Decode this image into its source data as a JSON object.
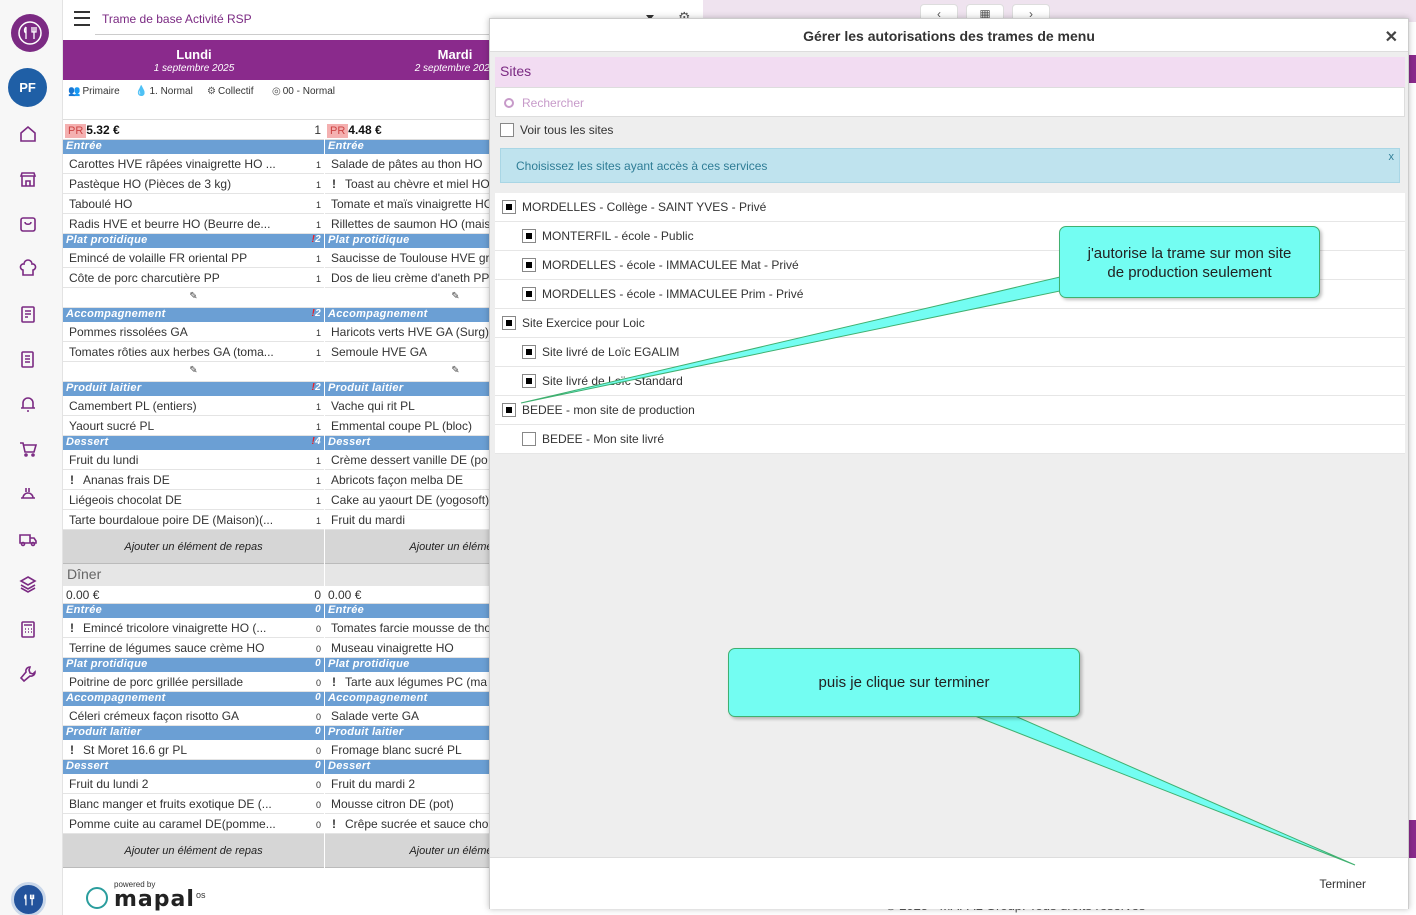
{
  "sidebar": {
    "avatar_initials": "PF",
    "icons": [
      "home-icon",
      "store-icon",
      "basket-icon",
      "chef-hat-icon",
      "recipe-icon",
      "document-icon",
      "bell-icon",
      "cart-icon",
      "dish-icon",
      "delivery-icon",
      "layers-icon",
      "calculator-icon",
      "wrench-icon"
    ]
  },
  "topbar": {
    "trame": "Trame de base Activité RSP",
    "prev": "‹",
    "next": "›",
    "calendar": "▦"
  },
  "days": [
    {
      "name": "Lundi",
      "date": "1 septembre 2025"
    },
    {
      "name": "Mardi",
      "date": "2 septembre 2025"
    }
  ],
  "attributes": [
    "Primaire",
    "1. Normal",
    "Collectif",
    "00 - Normal"
  ],
  "lunch": {
    "pr_label": "PR",
    "lundi": {
      "price": "5.32 €",
      "count": "1",
      "entree": [
        {
          "t": "Carottes HVE râpées vinaigrette HO ...",
          "q": "1"
        },
        {
          "t": "Pastèque HO (Pièces de 3 kg)",
          "q": "1"
        },
        {
          "t": "Taboulé HO",
          "q": "1"
        },
        {
          "t": "Radis HVE et beurre HO (Beurre de...",
          "q": "1"
        }
      ],
      "plat_count": "2",
      "plat": [
        {
          "t": "Emincé de volaille FR oriental PP",
          "q": "1"
        },
        {
          "t": "Côte de porc charcutière PP",
          "q": "1"
        }
      ],
      "acc_count": "2",
      "acc": [
        {
          "t": "Pommes rissolées GA",
          "q": "1"
        },
        {
          "t": "Tomates rôties aux herbes GA (toma...",
          "q": "1"
        }
      ],
      "lait_count": "2",
      "lait": [
        {
          "t": "Camembert PL (entiers)",
          "q": "1"
        },
        {
          "t": "Yaourt sucré PL",
          "q": "1"
        }
      ],
      "dessert_count": "4",
      "dessert": [
        {
          "t": "Fruit du lundi",
          "q": "1",
          "bang": false
        },
        {
          "t": "Ananas frais DE",
          "q": "1",
          "bang": true
        },
        {
          "t": "Liégeois chocolat DE",
          "q": "1",
          "bang": false
        },
        {
          "t": "Tarte bourdaloue poire DE (Maison)(...",
          "q": "1",
          "bang": false
        }
      ]
    },
    "mardi": {
      "price": "4.48 €",
      "entree": [
        {
          "t": "Salade de pâtes au thon HO",
          "bang": false
        },
        {
          "t": "Toast au chèvre et miel HO",
          "bang": true
        },
        {
          "t": "Tomate et maïs vinaigrette HO",
          "bang": false
        },
        {
          "t": "Rillettes de saumon HO (mais",
          "bang": false
        }
      ],
      "plat": [
        "Saucisse de Toulouse HVE gr",
        "Dos de lieu crème d'aneth PP"
      ],
      "acc": [
        "Haricots verts HVE GA (Surg)",
        "Semoule HVE GA"
      ],
      "lait": [
        "Vache qui rit PL",
        "Emmental coupe PL (bloc)"
      ],
      "dessert": [
        "Crème dessert vanille DE (po",
        "Abricots façon melba DE",
        "Cake au yaourt DE (yogosoft)",
        "Fruit du mardi"
      ]
    }
  },
  "categories": {
    "entree": "Entrée",
    "plat": "Plat protidique",
    "acc": "Accompagnement",
    "lait": "Produit laitier",
    "dessert": "Dessert"
  },
  "add_label_lundi": "Ajouter un élément de repas",
  "add_label_mardi": "Ajouter un élément",
  "edit_glyph": "✎",
  "bang_glyph": "!",
  "diner": {
    "title": "Dîner",
    "lundi": {
      "price": "0.00 €",
      "count": "0",
      "entree": [
        {
          "t": "Emincé tricolore vinaigrette HO (...",
          "q": "0",
          "bang": true
        },
        {
          "t": "Terrine de légumes sauce crème HO",
          "q": "0",
          "bang": false
        }
      ],
      "plat": [
        {
          "t": "Poitrine de porc grillée persillade",
          "q": "0",
          "bang": false
        }
      ],
      "acc": [
        {
          "t": "Céleri crémeux façon risotto GA",
          "q": "0",
          "bang": false
        }
      ],
      "lait": [
        {
          "t": "St Moret 16.6 gr PL",
          "q": "0",
          "bang": true
        }
      ],
      "dessert": [
        {
          "t": "Fruit du lundi 2",
          "q": "0",
          "bang": false
        },
        {
          "t": "Blanc manger et fruits exotique DE (...",
          "q": "0",
          "bang": false
        },
        {
          "t": "Pomme cuite au caramel DE(pomme...",
          "q": "0",
          "bang": false
        }
      ],
      "cat_count": "0"
    },
    "mardi": {
      "price": "0.00 €",
      "entree": [
        {
          "t": "Tomates farcie mousse de tho",
          "bang": false
        },
        {
          "t": "Museau vinaigrette HO",
          "bang": false
        }
      ],
      "plat": [
        {
          "t": "Tarte aux légumes PC (ma",
          "bang": true
        }
      ],
      "acc": [
        {
          "t": "Salade verte GA",
          "bang": false
        }
      ],
      "lait": [
        {
          "t": "Fromage blanc sucré PL",
          "bang": false
        }
      ],
      "dessert": [
        {
          "t": "Fruit du mardi 2",
          "bang": false
        },
        {
          "t": "Mousse citron DE (pot)",
          "bang": false
        },
        {
          "t": "Crêpe sucrée et sauce cho",
          "bang": true
        }
      ]
    }
  },
  "footer": {
    "powered": "powered by",
    "brand": "mapal",
    "os": "os",
    "copyright": "© 2025 - MAPAL Group. Tous droits réservés"
  },
  "modal": {
    "title": "Gérer les autorisations des trames de menu",
    "close": "✕",
    "sites_header": "Sites",
    "search_placeholder": "Rechercher",
    "voir_tous": "Voir tous les sites",
    "info": "Choisissez les sites ayant accès à ces services",
    "info_close": "x",
    "sites": [
      {
        "label": "MORDELLES - Collège - SAINT YVES - Privé",
        "level": 0,
        "checked": true
      },
      {
        "label": "MONTERFIL - école - Public",
        "level": 1,
        "checked": true
      },
      {
        "label": "MORDELLES - école - IMMACULEE Mat - Privé",
        "level": 1,
        "checked": true
      },
      {
        "label": "MORDELLES - école - IMMACULEE Prim - Privé",
        "level": 1,
        "checked": true
      },
      {
        "label": "Site Exercice pour Loic",
        "level": 0,
        "checked": true
      },
      {
        "label": "Site livré de Loïc EGALIM",
        "level": 1,
        "checked": true
      },
      {
        "label": "Site livré de Loïc Standard",
        "level": 1,
        "checked": true
      },
      {
        "label": "BEDEE - mon site de production",
        "level": 0,
        "checked": true
      },
      {
        "label": "BEDEE - Mon site livré",
        "level": 1,
        "checked": false
      }
    ],
    "terminer": "Terminer"
  },
  "callouts": {
    "first_line1": "j'autorise la trame sur mon site",
    "first_line2": "de production seulement",
    "second": "puis je clique sur terminer"
  },
  "colors": {
    "brand": "#8a2a8c",
    "category": "#6b9fd4",
    "callout": "#73fdf2",
    "info": "#bfe3ee"
  }
}
